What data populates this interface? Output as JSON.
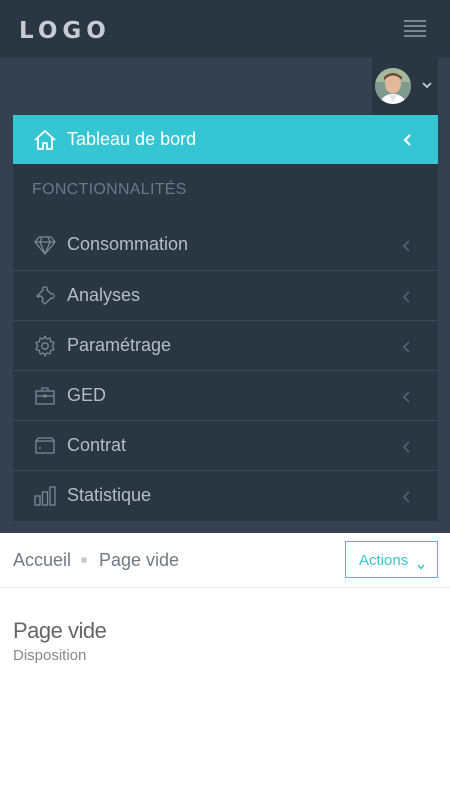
{
  "header": {
    "logo_text": "LOGO",
    "menu_icon": "hamburger-icon"
  },
  "user": {
    "avatar": "user-avatar",
    "dropdown_icon": "chevron-down-icon"
  },
  "sidebar": {
    "active_item": {
      "label": "Tableau de bord",
      "icon": "home-icon"
    },
    "section_heading": "FONCTIONNALITÉS",
    "items": [
      {
        "label": "Consommation",
        "icon": "diamond-icon"
      },
      {
        "label": "Analyses",
        "icon": "puzzle-icon"
      },
      {
        "label": "Paramétrage",
        "icon": "gear-icon"
      },
      {
        "label": "GED",
        "icon": "briefcase-icon"
      },
      {
        "label": "Contrat",
        "icon": "wallet-icon"
      },
      {
        "label": "Statistique",
        "icon": "bar-chart-icon"
      }
    ]
  },
  "breadcrumb": {
    "home": "Accueil",
    "current": "Page vide"
  },
  "actions": {
    "label": "Actions"
  },
  "page": {
    "title": "Page vide",
    "subtitle": "Disposition"
  },
  "colors": {
    "topbar": "#2b3643",
    "accent": "#36c6d3",
    "menu_bg": "#2b3643",
    "page_bg": "#364150"
  }
}
